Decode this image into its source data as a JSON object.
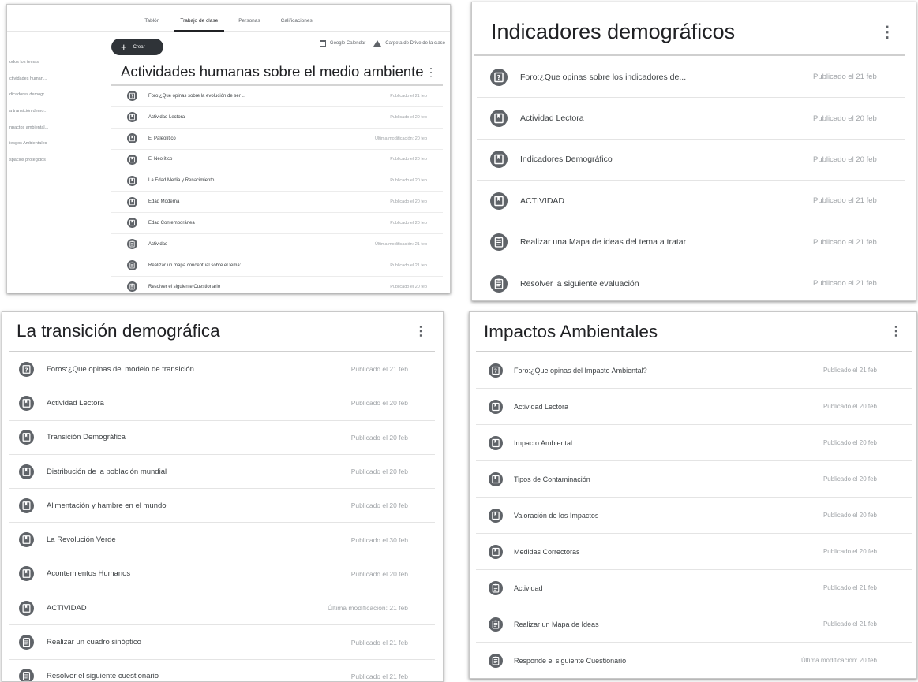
{
  "panel1": {
    "tabs": [
      "Tablón",
      "Trabajo de clase",
      "Personas",
      "Calificaciones"
    ],
    "create_label": "Crear",
    "calendar_label": "Google Calendar",
    "drive_label": "Carpeta de Drive de la clase",
    "sidebar": [
      "odos los temas",
      "ctividades human...",
      "dicadores demogr...",
      "a transición demo...",
      "npactos ambiental...",
      "iesgos Ambientales",
      "spacios protegidos"
    ],
    "title": "Actividades humanas sobre el medio ambiente",
    "kebab": "⋮",
    "items": [
      {
        "icon": "question-icon",
        "label": "Foro:¿Que opinas sobre la evolución de ser ...",
        "date": "Publicado el 21 feb"
      },
      {
        "icon": "material-icon",
        "label": "Actividad Lectora",
        "date": "Publicado el 20 feb"
      },
      {
        "icon": "material-icon",
        "label": "El Paleolítico",
        "date": "Última modificación: 20 feb"
      },
      {
        "icon": "material-icon",
        "label": "El Neolítico",
        "date": "Publicado el 20 feb"
      },
      {
        "icon": "material-icon",
        "label": "La Edad Media y Renacimiento",
        "date": "Publicado el 20 feb"
      },
      {
        "icon": "material-icon",
        "label": "Edad Moderna",
        "date": "Publicado el 20 feb"
      },
      {
        "icon": "material-icon",
        "label": "Edad Contemporánea",
        "date": "Publicado el 20 feb"
      },
      {
        "icon": "assignment-icon",
        "label": "Actividad",
        "date": "Última modificación: 21 feb"
      },
      {
        "icon": "assignment-icon",
        "label": "Realizar un mapa conceptual sobre el tema: ...",
        "date": "Publicado el 21 feb"
      },
      {
        "icon": "assignment-icon",
        "label": "Resolver el siguiente Cuestionario",
        "date": "Publicado el 20 feb"
      }
    ]
  },
  "panel2": {
    "title": "Indicadores demográficos",
    "kebab": "⋮",
    "items": [
      {
        "icon": "question-icon",
        "label": "Foro:¿Que opinas sobre los indicadores de...",
        "date": "Publicado el 21 feb"
      },
      {
        "icon": "material-icon",
        "label": "Actividad Lectora",
        "date": "Publicado el 20 feb"
      },
      {
        "icon": "material-icon",
        "label": "Indicadores Demográfico",
        "date": "Publicado el 20 feb"
      },
      {
        "icon": "material-icon",
        "label": "ACTIVIDAD",
        "date": "Publicado el 21 feb"
      },
      {
        "icon": "assignment-icon",
        "label": "Realizar una Mapa de ideas del tema a tratar",
        "date": "Publicado el 21 feb"
      },
      {
        "icon": "assignment-icon",
        "label": "Resolver la siguiente evaluación",
        "date": "Publicado el 21 feb"
      }
    ]
  },
  "panel3": {
    "title": "La transición demográfica",
    "kebab": "⋮",
    "items": [
      {
        "icon": "question-icon",
        "label": "Foros:¿Que opinas del modelo de transición...",
        "date": "Publicado el 21 feb"
      },
      {
        "icon": "material-icon",
        "label": "Actividad Lectora",
        "date": "Publicado el 20 feb"
      },
      {
        "icon": "material-icon",
        "label": "Transición Demográfica",
        "date": "Publicado el 20 feb"
      },
      {
        "icon": "material-icon",
        "label": "Distribución de la población mundial",
        "date": "Publicado el 20 feb"
      },
      {
        "icon": "material-icon",
        "label": "Alimentación y hambre en el mundo",
        "date": "Publicado el 20 feb"
      },
      {
        "icon": "material-icon",
        "label": "La Revolución Verde",
        "date": "Publicado el 30 feb"
      },
      {
        "icon": "material-icon",
        "label": "Acontemientos Humanos",
        "date": "Publicado el 20 feb"
      },
      {
        "icon": "material-icon",
        "label": "ACTIVIDAD",
        "date": "Última modificación: 21 feb"
      },
      {
        "icon": "assignment-icon",
        "label": "Realizar un cuadro sinóptico",
        "date": "Publicado el 21 feb"
      },
      {
        "icon": "assignment-icon",
        "label": "Resolver el siguiente cuestionario",
        "date": "Publicado el 21 feb"
      }
    ]
  },
  "panel4": {
    "title": "Impactos Ambientales",
    "kebab": "⋮",
    "items": [
      {
        "icon": "question-icon",
        "label": "Foro:¿Que opinas del Impacto Ambiental?",
        "date": "Publicado el 21 feb"
      },
      {
        "icon": "material-icon",
        "label": "Actividad Lectora",
        "date": "Publicado el 20 feb"
      },
      {
        "icon": "material-icon",
        "label": "Impacto Ambiental",
        "date": "Publicado el 20 feb"
      },
      {
        "icon": "material-icon",
        "label": "Tipos de Contaminación",
        "date": "Publicado el 20 feb"
      },
      {
        "icon": "material-icon",
        "label": "Valoración de los Impactos",
        "date": "Publicado el 20 feb"
      },
      {
        "icon": "material-icon",
        "label": "Medidas Correctoras",
        "date": "Publicado el 20 feb"
      },
      {
        "icon": "assignment-icon",
        "label": "Actividad",
        "date": "Publicado el 21 feb"
      },
      {
        "icon": "assignment-icon",
        "label": "Realizar un Mapa de Ideas",
        "date": "Publicado el 21 feb"
      },
      {
        "icon": "assignment-icon",
        "label": "Responde el siguiente Cuestionario",
        "date": "Última modificación: 20 feb"
      }
    ]
  },
  "colors": {
    "icon_bg": "#5f6368",
    "date_text": "#a0a4a8",
    "create_button": "#2f3338"
  }
}
